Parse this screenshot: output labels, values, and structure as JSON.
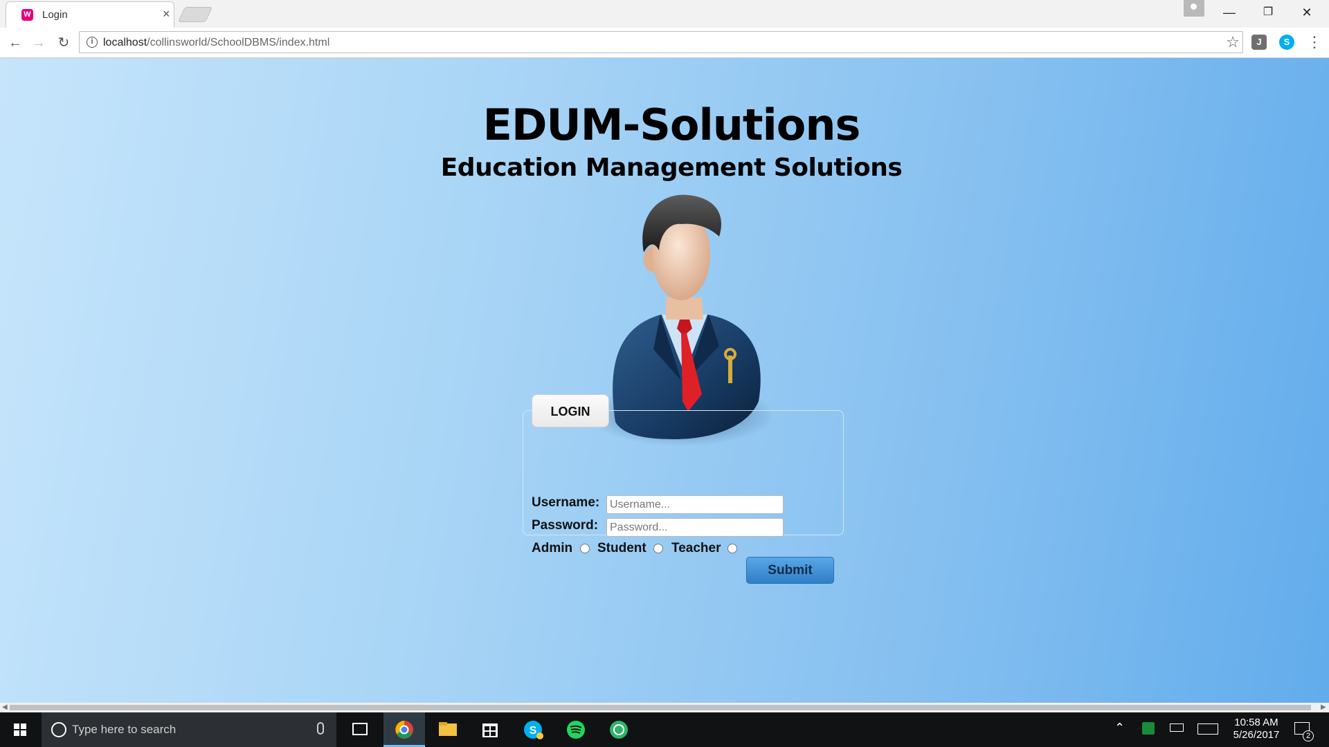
{
  "browser": {
    "tab": {
      "favicon": "W",
      "title": "Login",
      "close": "×"
    },
    "url": {
      "host": "localhost",
      "path": "/collinsworld/SchoolDBMS/index.html"
    },
    "controls": {
      "minimize": "—",
      "restore": "❐",
      "close": "✕"
    },
    "extension_icons": [
      "jb-icon",
      "skype-icon"
    ]
  },
  "page": {
    "title": "EDUM-Solutions",
    "subtitle": "Education Management Solutions",
    "login": {
      "legend": "LOGIN",
      "username_label": "Username:",
      "username_placeholder": "Username...",
      "password_label": "Password:",
      "password_placeholder": "Password...",
      "roles": [
        "Admin",
        "Student",
        "Teacher"
      ],
      "submit_label": "Submit"
    }
  },
  "taskbar": {
    "search_placeholder": "Type here to search",
    "apps": [
      "chrome-icon",
      "file-explorer-icon",
      "store-icon",
      "skype-icon",
      "spotify-icon",
      "browser-icon"
    ],
    "clock_time": "10:58 AM",
    "clock_date": "5/26/2017",
    "notification_count": "2"
  }
}
